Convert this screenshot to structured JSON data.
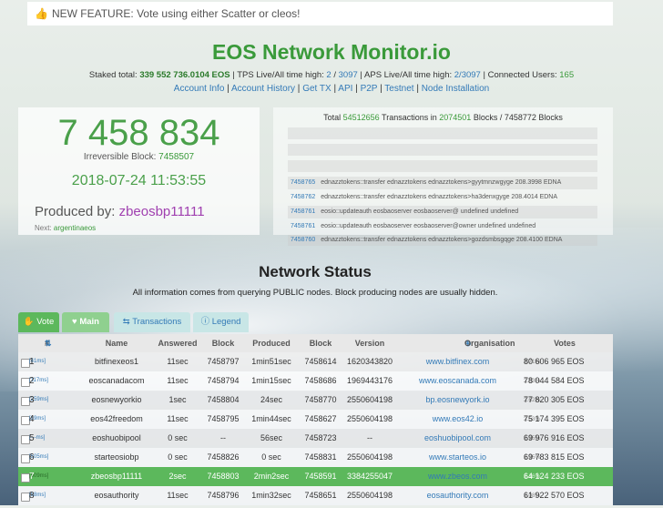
{
  "banner": {
    "text": "NEW FEATURE: Vote using either Scatter or cleos!"
  },
  "title": "EOS Network Monitor.io",
  "stats": {
    "staked_label": "Staked total:",
    "staked_value": "339 552 736.0104 EOS",
    "tps_label": "TPS Live/All time high:",
    "tps_live": "2",
    "tps_high": "3097",
    "aps_label": "APS Live/All time high:",
    "aps_value": "2/3097",
    "users_label": "Connected Users:",
    "users_value": "165"
  },
  "links": [
    "Account Info",
    "Account History",
    "Get TX",
    "API",
    "P2P",
    "Testnet",
    "Node Installation"
  ],
  "head_block": {
    "number": "7 458 834",
    "irreversible_label": "Irreversible Block:",
    "irreversible_value": "7458507",
    "datetime": "2018-07-24 11:53:55",
    "produced_label": "Produced by:",
    "producer": "zbeosbp11111",
    "next_label": "Next:",
    "next_producer": "argentinaeos"
  },
  "totals": {
    "prefix": "Total",
    "transactions": "54512656",
    "mid1": "Transactions in",
    "blocks": "2074501",
    "mid2": "Blocks / 7458772 Blocks"
  },
  "transactions": [
    {
      "id": "7458765",
      "text": "ednazztokens::transfer   ednazztokens   ednazztokens>gyytmnzwgyge   208.3998 EDNA"
    },
    {
      "id": "7458762",
      "text": "ednazztokens::transfer   ednazztokens   ednazztokens>ha3denxgyge   208.4014 EDNA"
    },
    {
      "id": "7458761",
      "text": "eosio::updateauth   eosbaoserver   eosbaoserver@   undefined   undefined"
    },
    {
      "id": "7458761",
      "text": "eosio::updateauth   eosbaoserver   eosbaoserver@owner   undefined   undefined"
    },
    {
      "id": "7458760",
      "text": "ednazztokens::transfer   ednazztokens   ednazztokens>gozdsmbsgqge   208.4100 EDNA"
    }
  ],
  "network": {
    "title": "Network Status",
    "subtitle": "All information comes from querying PUBLIC nodes. Block producing nodes are usually hidden."
  },
  "tabs": [
    "Vote",
    "Main",
    "Transactions",
    "Legend"
  ],
  "columns": [
    "#",
    "Name",
    "Answered",
    "Block",
    "Produced",
    "Block",
    "Version",
    "Organisation",
    "Votes"
  ],
  "rows": [
    {
      "rank": "1",
      "prev": "[41ms]",
      "name": "bitfinexeos1",
      "answered": "11sec",
      "block": "7458797",
      "produced": "1min51sec",
      "block2": "7458614",
      "version": "1620343820",
      "org": "www.bitfinex.com",
      "votes": "80 606 965 EOS",
      "pct": "2.71%"
    },
    {
      "rank": "2",
      "prev": "[117ms]",
      "name": "eoscanadacom",
      "answered": "11sec",
      "block": "7458794",
      "produced": "1min15sec",
      "block2": "7458686",
      "version": "1969443176",
      "org": "www.eoscanada.com",
      "votes": "78 044 584 EOS",
      "pct": "2.63%"
    },
    {
      "rank": "3",
      "prev": "[259ms]",
      "name": "eosnewyorkio",
      "answered": "1sec",
      "block": "7458804",
      "produced": "24sec",
      "block2": "7458770",
      "version": "2550604198",
      "org": "bp.eosnewyork.io",
      "votes": "77 820 305 EOS",
      "pct": "2.62%"
    },
    {
      "rank": "4",
      "prev": "[69ms]",
      "name": "eos42freedom",
      "answered": "11sec",
      "block": "7458795",
      "produced": "1min44sec",
      "block2": "7458627",
      "version": "2550604198",
      "org": "www.eos42.io",
      "votes": "75 174 395 EOS",
      "pct": "2.53%"
    },
    {
      "rank": "5",
      "prev": "[---ms]",
      "name": "eoshuobipool",
      "answered": "0 sec",
      "block": "--",
      "produced": "56sec",
      "block2": "7458723",
      "version": "--",
      "org": "eoshuobipool.com",
      "votes": "69 976 916 EOS",
      "pct": "2.35%"
    },
    {
      "rank": "6",
      "prev": "[505ms]",
      "name": "starteosiobp",
      "answered": "0 sec",
      "block": "7458826",
      "produced": "0 sec",
      "block2": "7458831",
      "version": "2550604198",
      "org": "www.starteos.io",
      "votes": "69 783 815 EOS",
      "pct": "2.35%"
    },
    {
      "rank": "7",
      "prev": "[509ms]",
      "name": "zbeosbp11111",
      "answered": "2sec",
      "block": "7458803",
      "produced": "2min2sec",
      "block2": "7458591",
      "version": "3384255047",
      "org": "www.zbeos.com",
      "votes": "64 124 233 EOS",
      "pct": "2.16%"
    },
    {
      "rank": "8",
      "prev": "[58ms]",
      "name": "eosauthority",
      "answered": "11sec",
      "block": "7458796",
      "produced": "1min32sec",
      "block2": "7458651",
      "version": "2550604198",
      "org": "eosauthority.com",
      "votes": "61 922 570 EOS",
      "pct": "2.08%"
    }
  ],
  "highlight_row": 6,
  "colors": {
    "accent": "#5cb85c",
    "title_green": "#3a9a3a",
    "link": "#337ab7",
    "producer": "#a040b0"
  }
}
